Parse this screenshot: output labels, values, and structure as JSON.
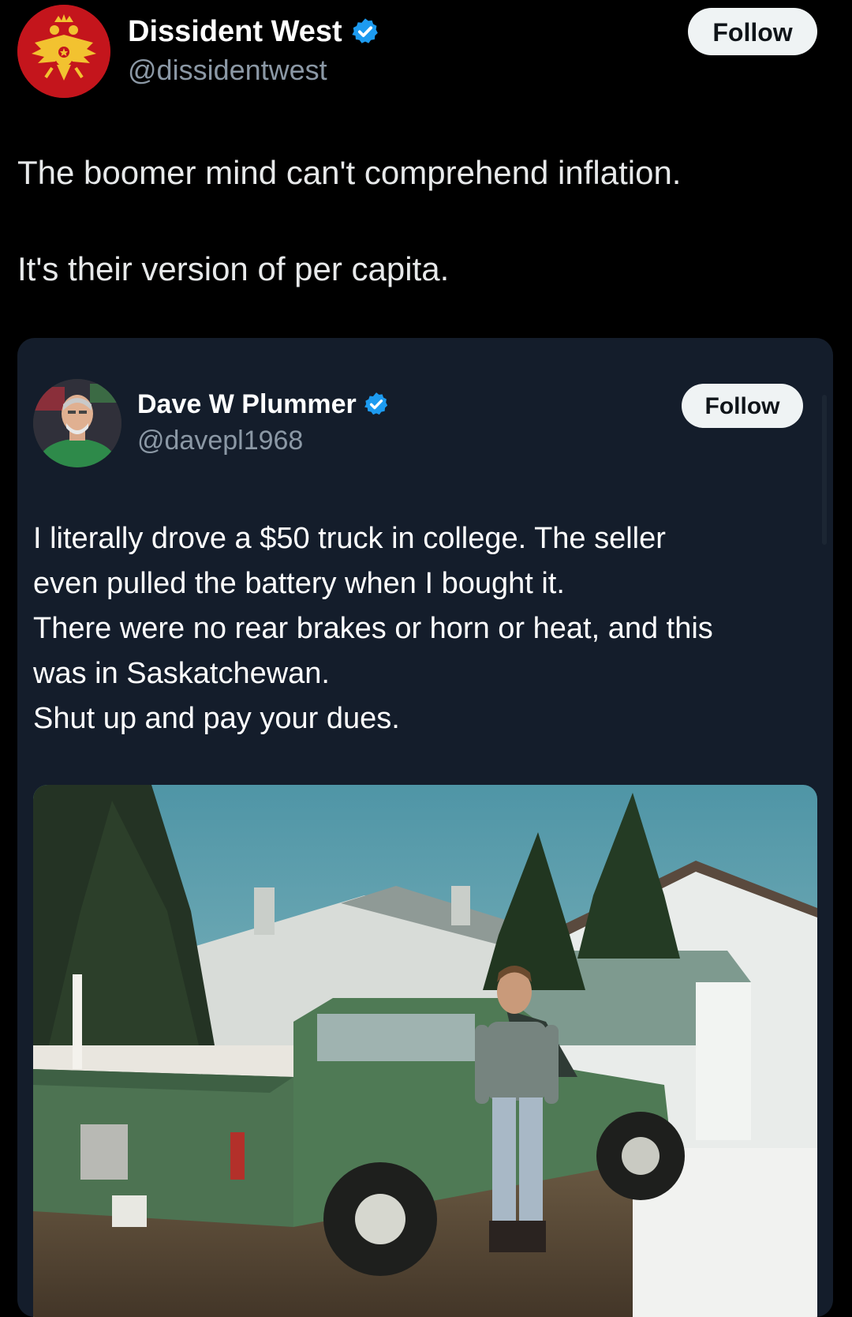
{
  "post": {
    "author": {
      "display_name": "Dissident West",
      "handle": "@dissidentwest",
      "verified": true,
      "avatar": "double-headed-eagle-emblem"
    },
    "follow_label": "Follow",
    "text_lines": [
      "The boomer mind can't comprehend inflation.",
      "It's their version of per capita."
    ]
  },
  "quoted_post": {
    "author": {
      "display_name": "Dave W Plummer",
      "handle": "@davepl1968",
      "verified": true,
      "avatar": "man-in-green-shirt-portrait"
    },
    "follow_label": "Follow",
    "text_lines": [
      "I literally drove a $50 truck in college.  The seller",
      "even pulled the battery when I bought it.",
      "There were no rear brakes or horn or heat, and this",
      "was in Saskatchewan.",
      "Shut up and pay your dues."
    ],
    "media": {
      "type": "photo",
      "subject": "young-man-standing-beside-green-pickup-truck"
    }
  },
  "colors": {
    "background": "#000000",
    "card_background": "#141d2b",
    "primary_text": "#e7e9ea",
    "secondary_text": "#8b98a5",
    "verified_blue": "#1d9bf0",
    "follow_button_bg": "#eff3f4",
    "avatar_red": "#c4151c"
  }
}
